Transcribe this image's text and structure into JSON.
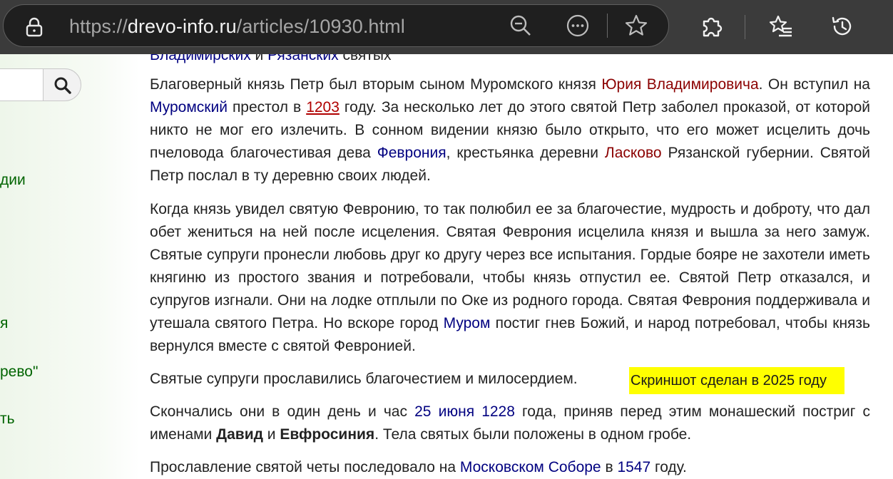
{
  "browser": {
    "url_scheme": "https://",
    "url_host": "drevo-info.ru",
    "url_path": "/articles/10930.html",
    "icons": [
      "lock-icon",
      "zoom-out-icon",
      "more-icon",
      "favorite-star-icon",
      "extensions-icon",
      "favorites-list-icon",
      "history-icon"
    ]
  },
  "sidebar": {
    "links": [
      "дии",
      "я",
      "рево\"",
      "ть"
    ]
  },
  "article": {
    "top_cut": [
      "Владимирских",
      " и ",
      "Рязанских",
      " святых"
    ],
    "p1": {
      "t1": "Благоверный князь Петр был вторым сыном Муромского князя ",
      "l1": "Юрия Владимировича",
      "t2": ". Он вступил на ",
      "l2": "Муромский",
      "t3": " престол в ",
      "l3": "1203",
      "t4": " году. За несколько лет до этого святой Петр заболел проказой, от которой никто не мог его излечить. В сонном видении князю было открыто, что его может исцелить дочь пчеловода благочестивая дева ",
      "l4": "Феврония",
      "t5": ", крестьянка деревни ",
      "l5": "Ласково",
      "t6": " Рязанской губернии. Святой Петр послал в ту деревню своих людей."
    },
    "p2": {
      "t1": "Когда князь увидел святую Февронию, то так полюбил ее за благочестие, мудрость и доброту, что дал обет жениться на ней после исцеления. Святая Феврония исцелила князя и вышла за него замуж. Святые супруги пронесли любовь друг ко другу через все испытания. Гордые бояре не захотели иметь княгиню из простого звания и потребовали, чтобы князь отпустил ее. Святой Петр отказался, и супругов изгнали. Они на лодке отплыли по Оке из родного города. Святая Феврония поддерживала и утешала святого Петра. Но вскоре город ",
      "l1": "Муром",
      "t2": " постиг гнев Божий, и народ потребовал, чтобы князь вернулся вместе с святой Февронией."
    },
    "p3": "Святые супруги прославились благочестием и милосердием.",
    "p4": {
      "t1": "Скончались они в один день и час ",
      "l1": "25 июня 1228",
      "t2": " года, приняв перед этим монашеский постриг с именами ",
      "b1": "Давид",
      "t3": " и ",
      "b2": "Евфросиния",
      "t4": ". Тела святых были положены в одном гробе."
    },
    "p5": {
      "t1": "Прославление святой четы последовало на ",
      "l1": "Московском Соборе",
      "t2": " в ",
      "l2": "1547",
      "t3": " году."
    }
  },
  "overlay": {
    "screenshot_note": "Скриншот сделан в 2025 году"
  },
  "colors": {
    "link_blue": "#000080",
    "link_red": "#8b0000",
    "sidebar_link": "#006400",
    "highlight": "#ffff00"
  }
}
